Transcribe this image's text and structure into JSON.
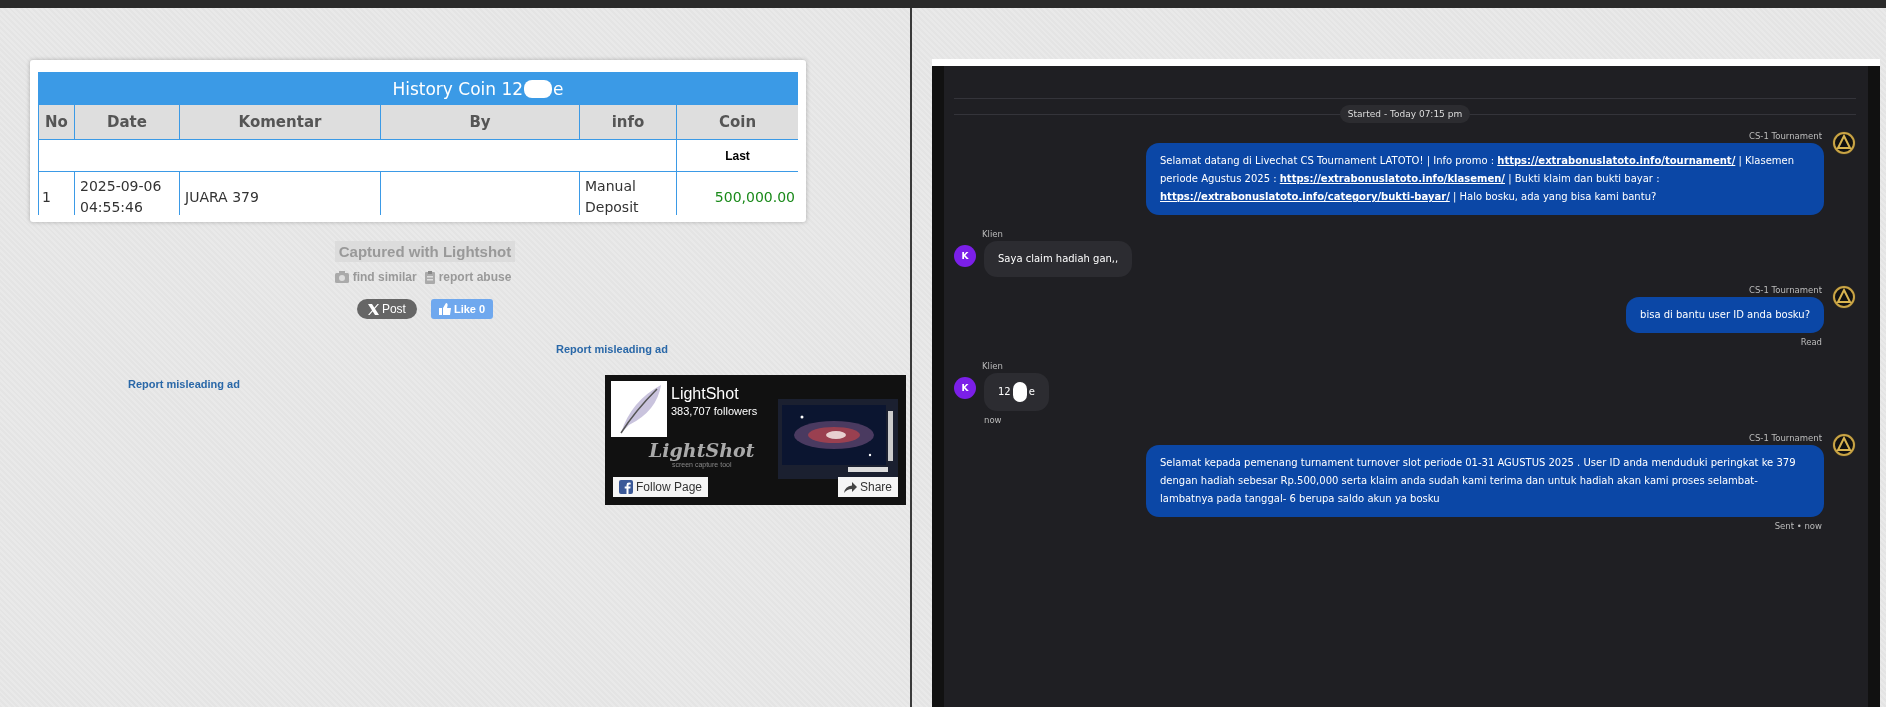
{
  "history_table": {
    "title": "History Coin 12",
    "title_end": "e",
    "columns": [
      "No",
      "Date",
      "Komentar",
      "By",
      "info",
      "Coin"
    ],
    "subheader": {
      "coin": "Last"
    },
    "rows": [
      {
        "no": "1",
        "date": "2025-09-06 04:55:46",
        "komentar": "JUARA 379",
        "info": "Manual Deposit",
        "coin": "500,000.00"
      }
    ]
  },
  "lightshot": {
    "caption": "Captured with Lightshot",
    "find_similar": "find similar",
    "report_abuse": "report abuse",
    "post_button": "Post",
    "like_button": "Like 0",
    "ad_reports": [
      "Report misleading ad",
      "Report misleading ad"
    ]
  },
  "facebook_widget": {
    "page_name": "LightShot",
    "followers": "383,707 followers",
    "logo_text": "LightShot",
    "tagline": "screen capture tool",
    "follow_button": "Follow Page",
    "share_button": "Share",
    "kind": "picture"
  },
  "chat": {
    "started": "Started - Today 07:15 pm",
    "messages": [
      {
        "kind": "agent",
        "sender": "CS-1 Tournament",
        "segments": [
          {
            "kind": "text",
            "text": "Selamat datang di Livechat CS Tournament LATOTO! | Info promo : "
          },
          {
            "kind": "link",
            "text": "https://extrabonuslatoto.info/tournament/"
          },
          {
            "kind": "text",
            "text": " | Klasemen periode Agustus 2025 : "
          },
          {
            "kind": "link",
            "text": "https://extrabonuslatoto.info/klasemen/"
          },
          {
            "kind": "text",
            "text": " | Bukti klaim dan bukti bayar : "
          },
          {
            "kind": "link",
            "text": "https://extrabonuslatoto.info/category/bukti-bayar/"
          },
          {
            "kind": "text",
            "text": " | Halo bosku, ada yang bisa kami bantu?"
          }
        ]
      },
      {
        "kind": "client",
        "sender": "Klien",
        "avatar": "K",
        "segments": [
          {
            "kind": "text",
            "text": "Saya claim hadiah gan,,"
          }
        ]
      },
      {
        "kind": "agent",
        "sender": "CS-1 Tournament",
        "status": "Read",
        "segments": [
          {
            "kind": "text",
            "text": "bisa di bantu user ID anda bosku?"
          }
        ]
      },
      {
        "kind": "client",
        "sender": "Klien",
        "avatar": "K",
        "status": "now",
        "redacted": true,
        "segments": [
          {
            "kind": "text",
            "text": "12"
          },
          {
            "kind": "text",
            "text": "e"
          }
        ]
      },
      {
        "kind": "agent",
        "sender": "CS-1 Tournament",
        "status": "Sent • now",
        "segments": [
          {
            "kind": "text",
            "text": "Selamat kepada pemenang turnament turnover slot periode 01-31 AGUSTUS 2025 . User ID anda menduduki peringkat ke 379 dengan hadiah sebesar Rp.500,000 serta klaim anda sudah kami terima dan untuk hadiah akan kami proses selambat-lambatnya pada tanggal- 6 berupa saldo akun ya bosku"
          }
        ]
      }
    ]
  }
}
